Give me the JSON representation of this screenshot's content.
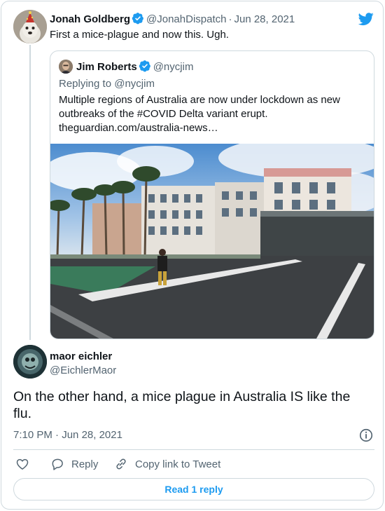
{
  "colors": {
    "accent": "#1d9bf0",
    "text": "#0f1419",
    "muted": "#536471",
    "border": "#cfd9de"
  },
  "tweet1": {
    "display_name": "Jonah Goldberg",
    "handle": "@JonahDispatch",
    "separator": "·",
    "date": "Jun 28, 2021",
    "text": "First a mice-plague and now this. Ugh.",
    "verified": true
  },
  "quote": {
    "display_name": "Jim Roberts",
    "handle": "@nycjim",
    "replying_to": "Replying to @nycjim",
    "text": "Multiple regions of Australia are now under lockdown as new outbreaks of the #COVID Delta variant erupt.",
    "link": "theguardian.com/australia-news…",
    "verified": true,
    "image_description_icon": "photo-street-palm-trees"
  },
  "tweet2": {
    "display_name": "maor eichler",
    "handle": "@EichlerMaor",
    "text": "On the other hand, a mice plague in Australia IS like the flu.",
    "time": "7:10 PM",
    "separator": "·",
    "date": "Jun 28, 2021"
  },
  "actions": {
    "like_icon": "heart-icon",
    "reply_label": "Reply",
    "copy_label": "Copy link to Tweet"
  },
  "read_reply_label": "Read 1 reply"
}
